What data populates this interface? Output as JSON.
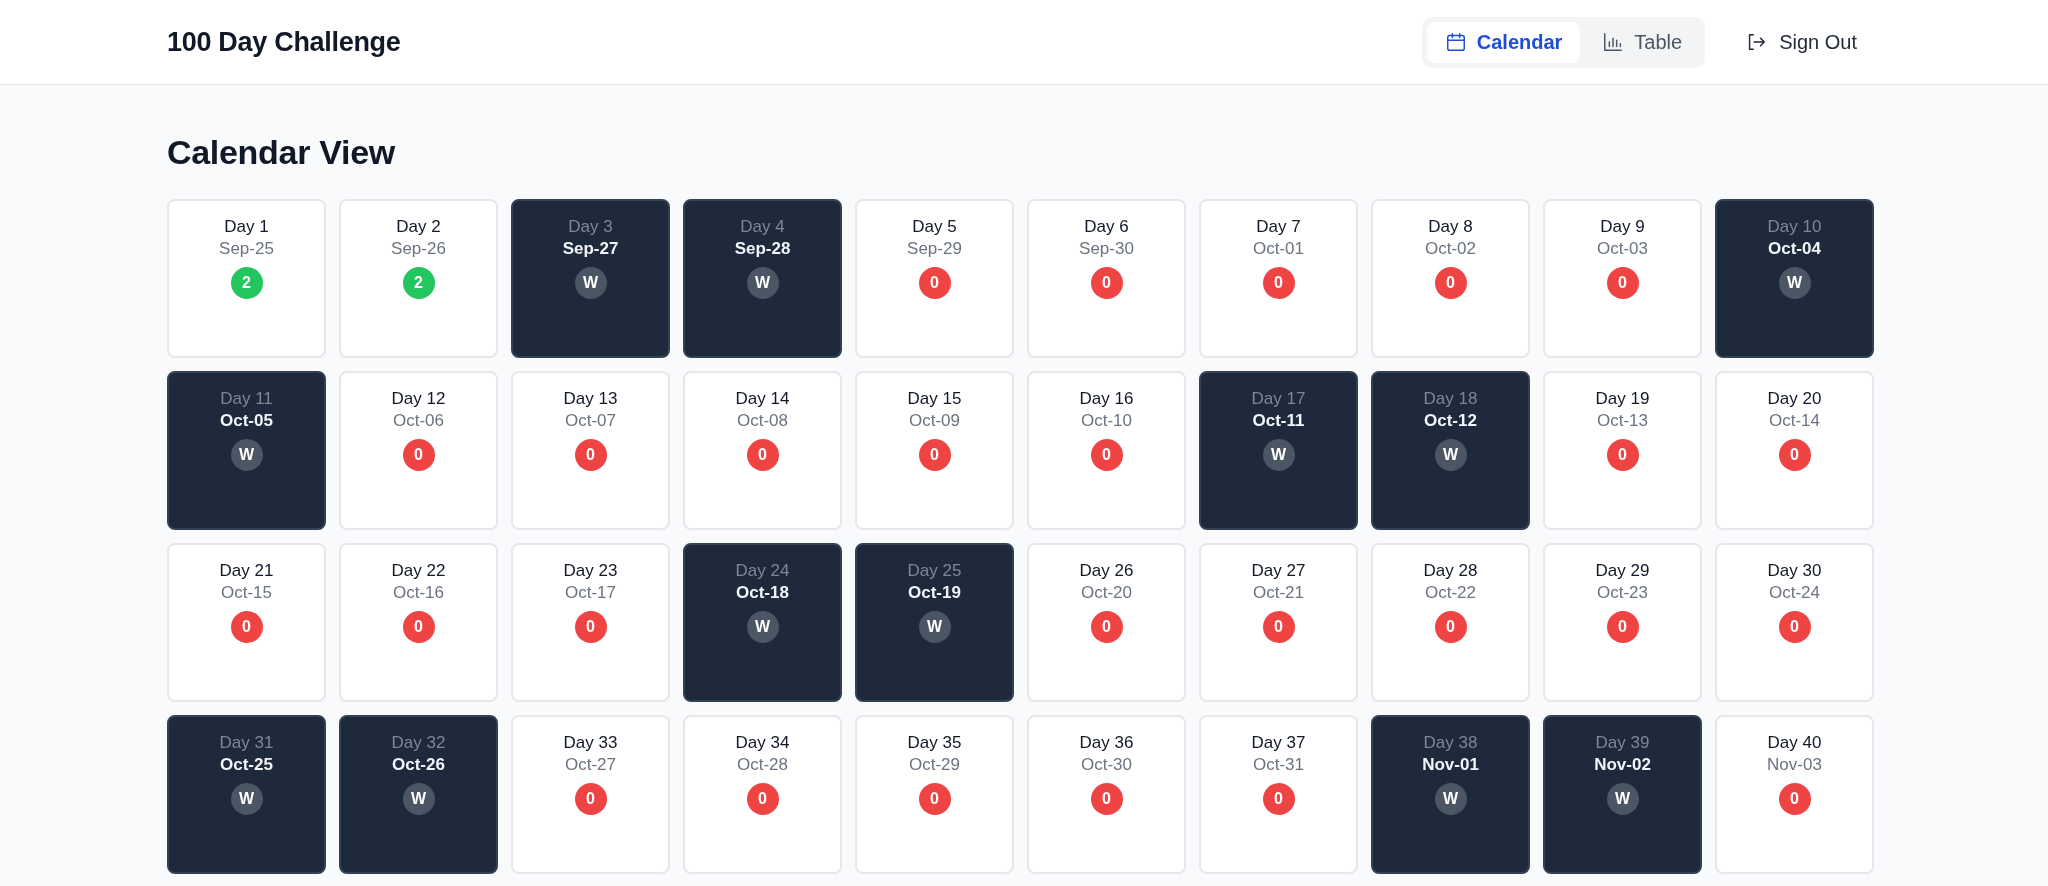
{
  "header": {
    "title": "100 Day Challenge",
    "tabs": [
      {
        "label": "Calendar",
        "selected": true
      },
      {
        "label": "Table",
        "selected": false
      }
    ],
    "sign_out": "Sign Out"
  },
  "page_title": "Calendar View",
  "days": [
    {
      "label": "Day 1",
      "date": "Sep-25",
      "weekend": false,
      "badge": "2",
      "color": "#22c55e"
    },
    {
      "label": "Day 2",
      "date": "Sep-26",
      "weekend": false,
      "badge": "2",
      "color": "#22c55e"
    },
    {
      "label": "Day 3",
      "date": "Sep-27",
      "weekend": true,
      "badge": "W",
      "color": "#4b5563"
    },
    {
      "label": "Day 4",
      "date": "Sep-28",
      "weekend": true,
      "badge": "W",
      "color": "#4b5563"
    },
    {
      "label": "Day 5",
      "date": "Sep-29",
      "weekend": false,
      "badge": "0",
      "color": "#ef4444"
    },
    {
      "label": "Day 6",
      "date": "Sep-30",
      "weekend": false,
      "badge": "0",
      "color": "#ef4444"
    },
    {
      "label": "Day 7",
      "date": "Oct-01",
      "weekend": false,
      "badge": "0",
      "color": "#ef4444"
    },
    {
      "label": "Day 8",
      "date": "Oct-02",
      "weekend": false,
      "badge": "0",
      "color": "#ef4444"
    },
    {
      "label": "Day 9",
      "date": "Oct-03",
      "weekend": false,
      "badge": "0",
      "color": "#ef4444"
    },
    {
      "label": "Day 10",
      "date": "Oct-04",
      "weekend": true,
      "badge": "W",
      "color": "#4b5563"
    },
    {
      "label": "Day 11",
      "date": "Oct-05",
      "weekend": true,
      "badge": "W",
      "color": "#4b5563"
    },
    {
      "label": "Day 12",
      "date": "Oct-06",
      "weekend": false,
      "badge": "0",
      "color": "#ef4444"
    },
    {
      "label": "Day 13",
      "date": "Oct-07",
      "weekend": false,
      "badge": "0",
      "color": "#ef4444"
    },
    {
      "label": "Day 14",
      "date": "Oct-08",
      "weekend": false,
      "badge": "0",
      "color": "#ef4444"
    },
    {
      "label": "Day 15",
      "date": "Oct-09",
      "weekend": false,
      "badge": "0",
      "color": "#ef4444"
    },
    {
      "label": "Day 16",
      "date": "Oct-10",
      "weekend": false,
      "badge": "0",
      "color": "#ef4444"
    },
    {
      "label": "Day 17",
      "date": "Oct-11",
      "weekend": true,
      "badge": "W",
      "color": "#4b5563"
    },
    {
      "label": "Day 18",
      "date": "Oct-12",
      "weekend": true,
      "badge": "W",
      "color": "#4b5563"
    },
    {
      "label": "Day 19",
      "date": "Oct-13",
      "weekend": false,
      "badge": "0",
      "color": "#ef4444"
    },
    {
      "label": "Day 20",
      "date": "Oct-14",
      "weekend": false,
      "badge": "0",
      "color": "#ef4444"
    },
    {
      "label": "Day 21",
      "date": "Oct-15",
      "weekend": false,
      "badge": "0",
      "color": "#ef4444"
    },
    {
      "label": "Day 22",
      "date": "Oct-16",
      "weekend": false,
      "badge": "0",
      "color": "#ef4444"
    },
    {
      "label": "Day 23",
      "date": "Oct-17",
      "weekend": false,
      "badge": "0",
      "color": "#ef4444"
    },
    {
      "label": "Day 24",
      "date": "Oct-18",
      "weekend": true,
      "badge": "W",
      "color": "#4b5563"
    },
    {
      "label": "Day 25",
      "date": "Oct-19",
      "weekend": true,
      "badge": "W",
      "color": "#4b5563"
    },
    {
      "label": "Day 26",
      "date": "Oct-20",
      "weekend": false,
      "badge": "0",
      "color": "#ef4444"
    },
    {
      "label": "Day 27",
      "date": "Oct-21",
      "weekend": false,
      "badge": "0",
      "color": "#ef4444"
    },
    {
      "label": "Day 28",
      "date": "Oct-22",
      "weekend": false,
      "badge": "0",
      "color": "#ef4444"
    },
    {
      "label": "Day 29",
      "date": "Oct-23",
      "weekend": false,
      "badge": "0",
      "color": "#ef4444"
    },
    {
      "label": "Day 30",
      "date": "Oct-24",
      "weekend": false,
      "badge": "0",
      "color": "#ef4444"
    },
    {
      "label": "Day 31",
      "date": "Oct-25",
      "weekend": true,
      "badge": "W",
      "color": "#4b5563"
    },
    {
      "label": "Day 32",
      "date": "Oct-26",
      "weekend": true,
      "badge": "W",
      "color": "#4b5563"
    },
    {
      "label": "Day 33",
      "date": "Oct-27",
      "weekend": false,
      "badge": "0",
      "color": "#ef4444"
    },
    {
      "label": "Day 34",
      "date": "Oct-28",
      "weekend": false,
      "badge": "0",
      "color": "#ef4444"
    },
    {
      "label": "Day 35",
      "date": "Oct-29",
      "weekend": false,
      "badge": "0",
      "color": "#ef4444"
    },
    {
      "label": "Day 36",
      "date": "Oct-30",
      "weekend": false,
      "badge": "0",
      "color": "#ef4444"
    },
    {
      "label": "Day 37",
      "date": "Oct-31",
      "weekend": false,
      "badge": "0",
      "color": "#ef4444"
    },
    {
      "label": "Day 38",
      "date": "Nov-01",
      "weekend": true,
      "badge": "W",
      "color": "#4b5563"
    },
    {
      "label": "Day 39",
      "date": "Nov-02",
      "weekend": true,
      "badge": "W",
      "color": "#4b5563"
    },
    {
      "label": "Day 40",
      "date": "Nov-03",
      "weekend": false,
      "badge": "0",
      "color": "#ef4444"
    }
  ]
}
